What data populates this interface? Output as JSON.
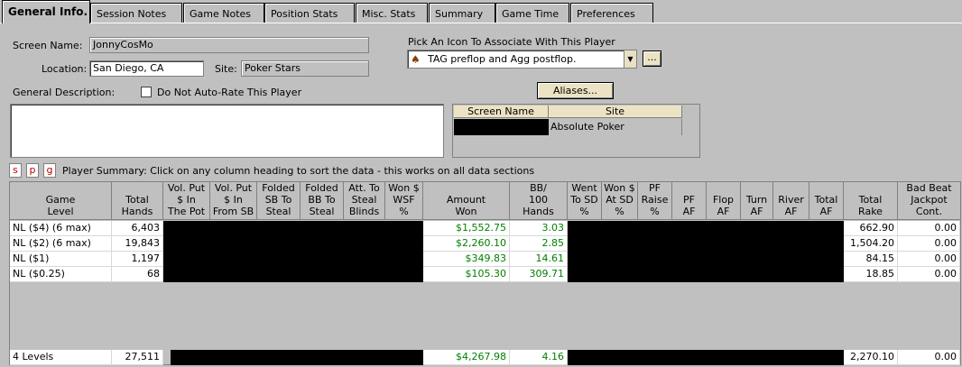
{
  "tabs": [
    {
      "label": "General Info.",
      "active": true
    },
    {
      "label": "Session Notes"
    },
    {
      "label": "Game Notes"
    },
    {
      "label": "Position Stats"
    },
    {
      "label": "Misc. Stats"
    },
    {
      "label": "Summary"
    },
    {
      "label": "Game Time"
    },
    {
      "label": "Preferences"
    }
  ],
  "form": {
    "screen_name_label": "Screen Name:",
    "screen_name": "JonnyCosMo",
    "location_label": "Location:",
    "location": "San Diego, CA",
    "site_label": "Site:",
    "site": "Poker Stars",
    "general_description_label": "General Description:",
    "auto_rate_label": "Do Not Auto-Rate This Player",
    "icon_label": "Pick An Icon To Associate With This Player",
    "icon_selected": "TAG preflop and Agg postflop.",
    "browse_button": "...",
    "aliases_button": "Aliases...",
    "description": ""
  },
  "aliases": {
    "headers": [
      "Screen Name",
      "Site"
    ],
    "rows": [
      {
        "screen_name": "",
        "site": "Absolute Poker"
      }
    ]
  },
  "summary_bar": {
    "buttons": [
      "s",
      "p",
      "g"
    ],
    "text": "Player Summary: Click on any column heading to sort the data - this works on all data sections"
  },
  "table": {
    "headers": [
      "Game\nLevel",
      "Total\nHands",
      "Vol. Put\n$ In\nThe Pot",
      "Vol. Put\n$ In\nFrom SB",
      "Folded\nSB To\nSteal",
      "Folded\nBB To\nSteal",
      "Att. To\nSteal\nBlinds",
      "Won $\nWSF\n%",
      "Amount\nWon",
      "BB/\n100\nHands",
      "Went\nTo SD\n%",
      "Won $\nAt SD\n%",
      "PF\nRaise\n%",
      "PF\nAF",
      "Flop\nAF",
      "Turn\nAF",
      "River\nAF",
      "Total\nAF",
      "Total\nRake",
      "Bad Beat\nJackpot\nCont."
    ],
    "rows": [
      {
        "level": "NL ($4) (6 max)",
        "hands": "6,403",
        "won": "$1,552.75",
        "bb100": "3.03",
        "rake": "662.90",
        "jackpot": "0.00"
      },
      {
        "level": "NL ($2) (6 max)",
        "hands": "19,843",
        "won": "$2,260.10",
        "bb100": "2.85",
        "rake": "1,504.20",
        "jackpot": "0.00"
      },
      {
        "level": "NL ($1)",
        "hands": "1,197",
        "won": "$349.83",
        "bb100": "14.61",
        "rake": "84.15",
        "jackpot": "0.00"
      },
      {
        "level": "NL ($0.25)",
        "hands": "68",
        "won": "$105.30",
        "bb100": "309.71",
        "rake": "18.85",
        "jackpot": "0.00"
      }
    ],
    "totals": {
      "level": "4 Levels",
      "hands": "27,511",
      "won": "$4,267.98",
      "bb100": "4.16",
      "rake": "2,270.10",
      "jackpot": "0.00"
    }
  }
}
